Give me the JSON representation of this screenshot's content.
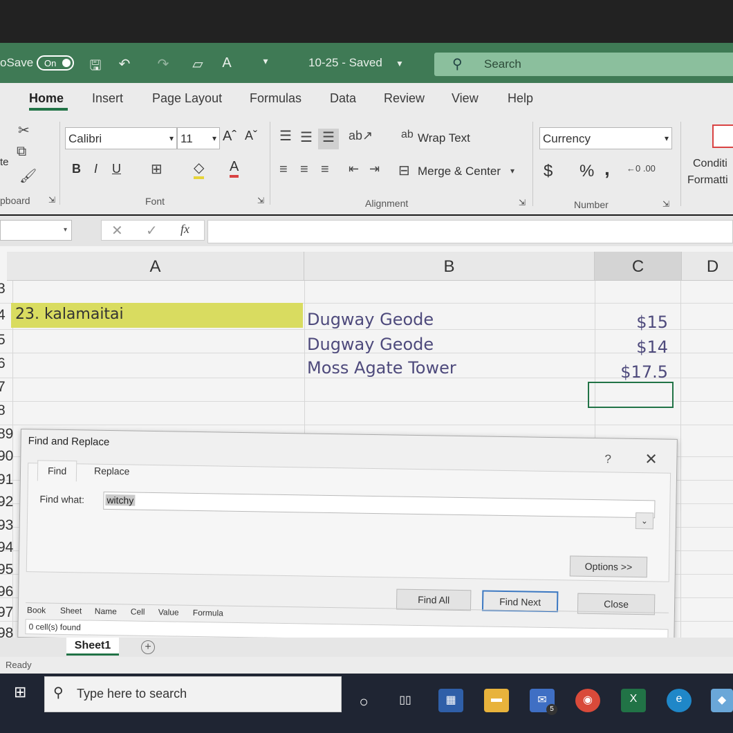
{
  "titlebar": {
    "autosave_label": "oSave",
    "autosave_state": "On",
    "doc_title": "10-25  -  Saved",
    "search_placeholder": "Search"
  },
  "ribbon": {
    "tabs": [
      "Home",
      "Insert",
      "Page Layout",
      "Formulas",
      "Data",
      "Review",
      "View",
      "Help"
    ],
    "active_tab": "Home",
    "clipboard": {
      "paste_label": "te",
      "group_label": "pboard"
    },
    "font": {
      "font_name": "Calibri",
      "font_size": "11",
      "grow_label": "Aˆ",
      "shrink_label": "Aˇ",
      "bold": "B",
      "italic": "I",
      "underline": "U",
      "font_color_letter": "A",
      "group_label": "Font"
    },
    "alignment": {
      "wrap_text": "Wrap Text",
      "merge_center": "Merge & Center",
      "group_label": "Alignment"
    },
    "number": {
      "format": "Currency",
      "currency_symbol": "$",
      "percent": "%",
      "comma": ",",
      "group_label": "Number"
    },
    "styles": {
      "conditional_line1": "Conditi",
      "conditional_line2": "Formatti"
    }
  },
  "formula_bar": {
    "fx": "fx",
    "value": ""
  },
  "sheet": {
    "columns": [
      "A",
      "B",
      "C",
      "D"
    ],
    "row_numbers": [
      "3",
      "4",
      "5",
      "6",
      "7",
      "8",
      "89",
      "90",
      "91",
      "92",
      "93",
      "94",
      "95",
      "96",
      "97",
      "98"
    ],
    "row_a": "23. kalamaitai",
    "rows": [
      {
        "item": "Dugway Geode",
        "price": "$15"
      },
      {
        "item": "Dugway Geode",
        "price": "$14"
      },
      {
        "item": "Moss Agate Tower",
        "price": "$17.5"
      }
    ],
    "sheet_tab": "Sheet1",
    "add_sheet": "+"
  },
  "dialog": {
    "title": "Find and Replace",
    "help": "?",
    "close": "✕",
    "tabs": {
      "find": "Find",
      "replace": "Replace"
    },
    "find_what_label": "Find what:",
    "find_what_value": "witchy",
    "options_button": "Options >>",
    "find_all_button": "Find All",
    "find_next_button": "Find Next",
    "close_button": "Close",
    "result_columns": [
      "Book",
      "Sheet",
      "Name",
      "Cell",
      "Value",
      "Formula"
    ],
    "status": "0 cell(s) found"
  },
  "statusbar": {
    "ready": "Ready"
  },
  "taskbar": {
    "search_placeholder": "Type here to search",
    "mail_badge": "5"
  }
}
